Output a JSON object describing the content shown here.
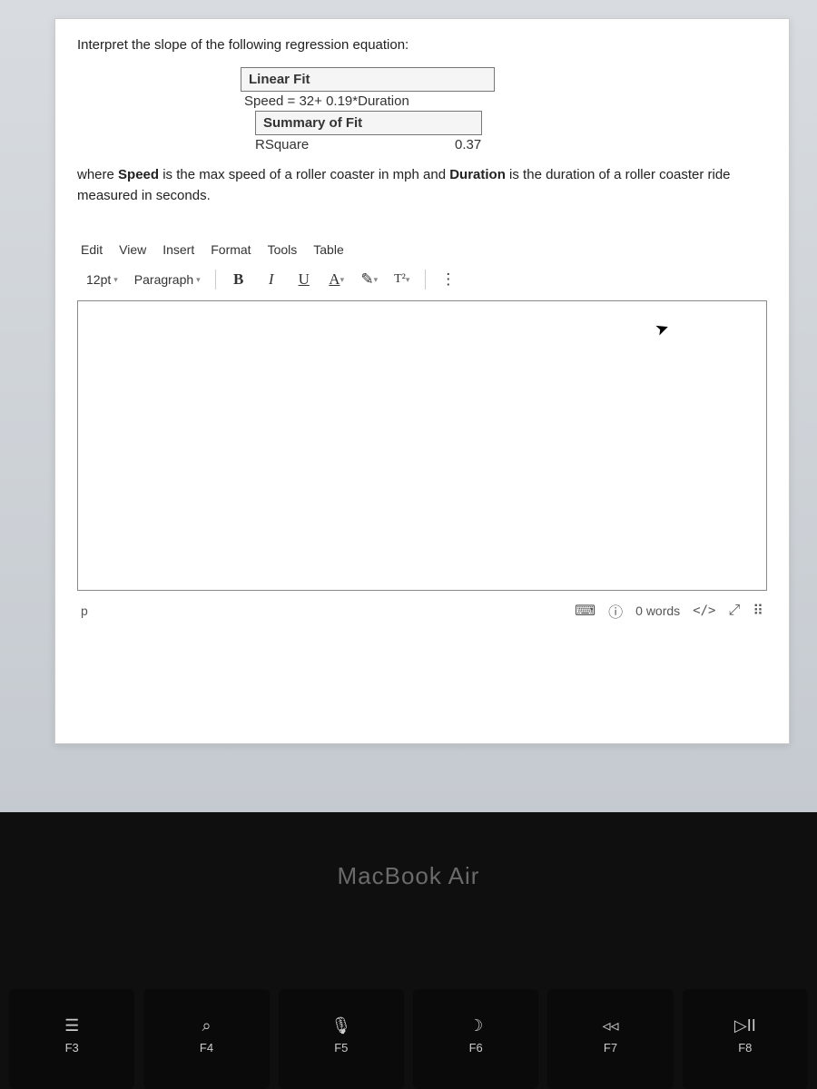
{
  "question": {
    "intro": "Interpret the slope of the following regression equation:",
    "linear_fit_header": "Linear Fit",
    "equation": "Speed = 32+ 0.19*Duration",
    "summary_header": "Summary of Fit",
    "rsquare_label": "RSquare",
    "rsquare_value": "0.37",
    "desc_prefix": "where ",
    "desc_bold1": "Speed",
    "desc_mid1": " is the max speed of a roller coaster in mph and ",
    "desc_bold2": "Duration",
    "desc_mid2": " is the duration of a roller coaster ride measured in seconds."
  },
  "editor": {
    "menus": [
      "Edit",
      "View",
      "Insert",
      "Format",
      "Tools",
      "Table"
    ],
    "font_size": "12pt",
    "style": "Paragraph",
    "bold": "B",
    "italic": "I",
    "underline": "U",
    "textcolor": "A",
    "highlight": "✎",
    "superscript": "T²",
    "more": "⋮",
    "path": "p",
    "word_count": "0 words",
    "code_view": "</>",
    "fullscreen": "⤢",
    "drag": "⠿"
  },
  "laptop": {
    "brand": "MacBook Air",
    "keys": [
      {
        "icon": "⌕⃞",
        "label": "F3",
        "name": "expose"
      },
      {
        "icon": "⌕",
        "label": "F4",
        "name": "search"
      },
      {
        "icon": "🎙",
        "label": "F5",
        "name": "mic"
      },
      {
        "icon": "☽",
        "label": "F6",
        "name": "dnd"
      },
      {
        "icon": "◃◃",
        "label": "F7",
        "name": "rewind"
      },
      {
        "icon": "▷II",
        "label": "F8",
        "name": "play-pause"
      }
    ]
  }
}
